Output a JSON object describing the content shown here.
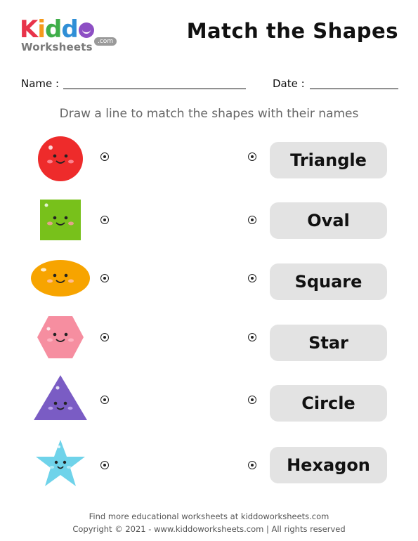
{
  "header": {
    "logo_letters": [
      "K",
      "i",
      "d",
      "d"
    ],
    "logo_letter_colors": [
      "#e8334a",
      "#f59a1b",
      "#3fae49",
      "#2f8fd6"
    ],
    "logo_sub": "Worksheets",
    "logo_com": ".com",
    "title": "Match the Shapes"
  },
  "fields": {
    "name_label": "Name :",
    "date_label": "Date :"
  },
  "instruction": "Draw a line to match the shapes with their names",
  "rows": [
    {
      "shape_icon": "circle-icon",
      "shape_color": "#ee2b2b",
      "name": "Triangle"
    },
    {
      "shape_icon": "square-icon",
      "shape_color": "#78c11b",
      "name": "Oval"
    },
    {
      "shape_icon": "oval-icon",
      "shape_color": "#f7a400",
      "name": "Square"
    },
    {
      "shape_icon": "hexagon-icon",
      "shape_color": "#f68ea0",
      "name": "Star"
    },
    {
      "shape_icon": "triangle-icon",
      "shape_color": "#7a5cc4",
      "name": "Circle"
    },
    {
      "shape_icon": "star-icon",
      "shape_color": "#6fd3ea",
      "name": "Hexagon"
    }
  ],
  "footer": {
    "line1": "Find more educational worksheets at kiddoworksheets.com",
    "line2": "Copyright © 2021 - www.kiddoworksheets.com  |  All rights reserved"
  }
}
